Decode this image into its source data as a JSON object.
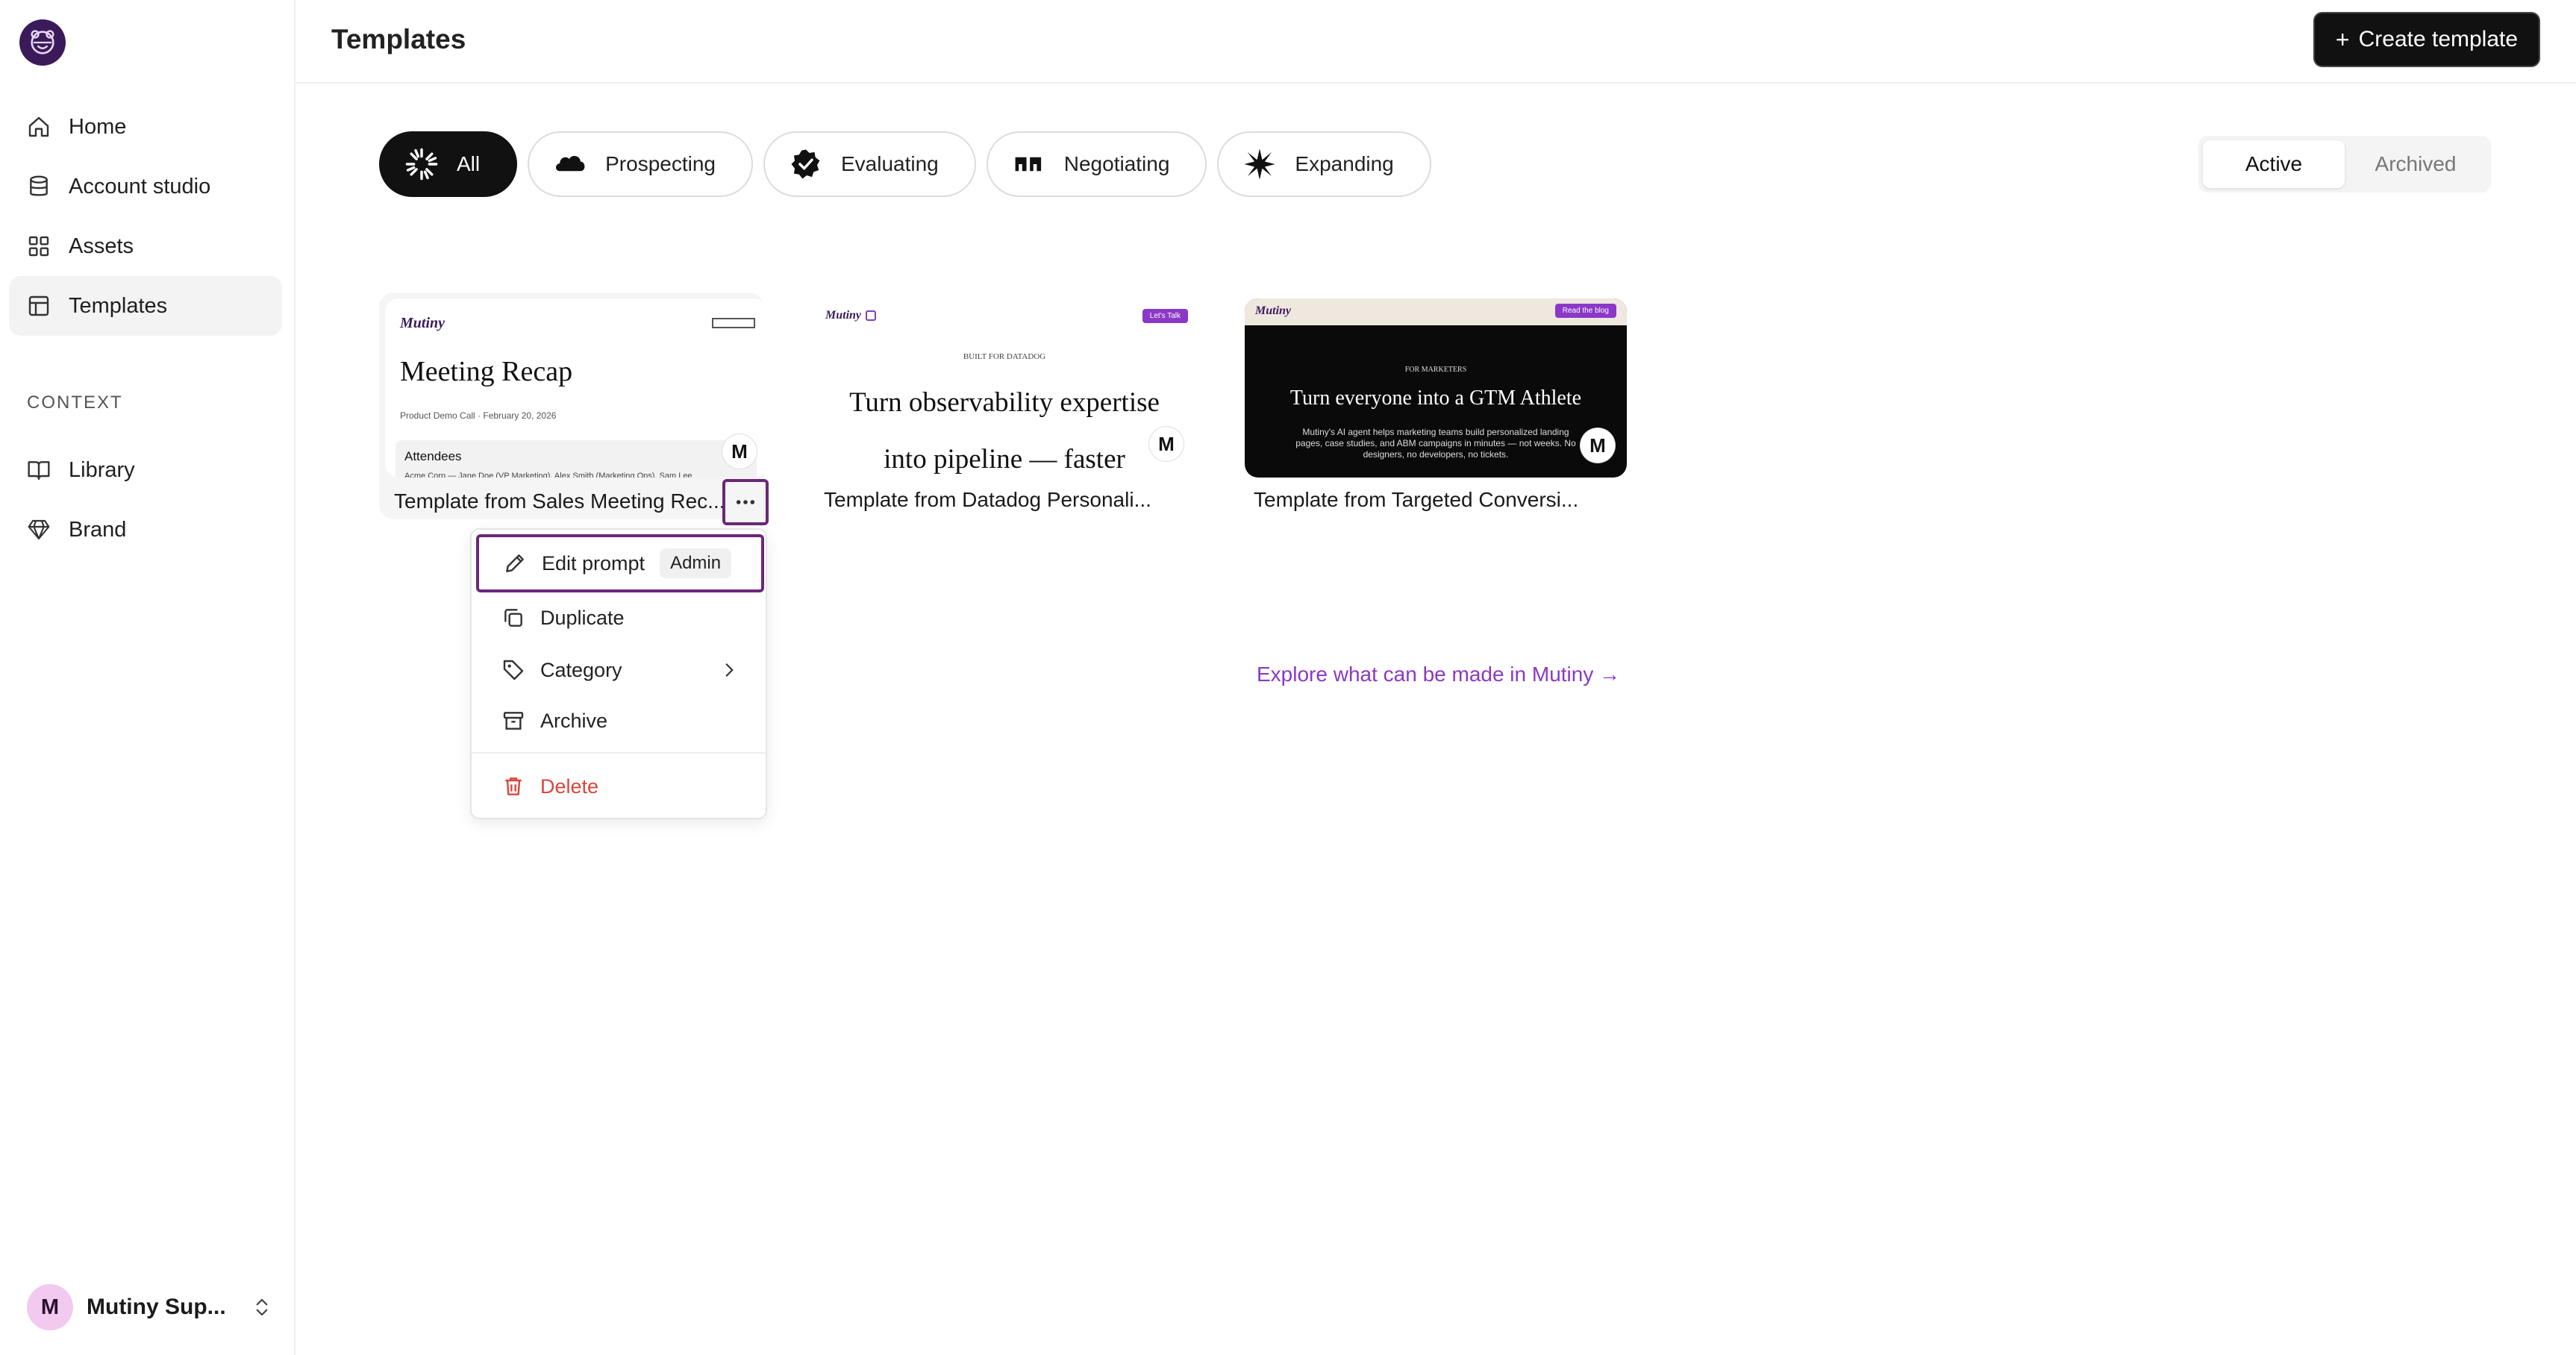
{
  "app": {
    "title": "Templates"
  },
  "sidebar": {
    "nav": [
      {
        "label": "Home",
        "icon": "home-icon"
      },
      {
        "label": "Account studio",
        "icon": "database-icon"
      },
      {
        "label": "Assets",
        "icon": "grid-icon"
      },
      {
        "label": "Templates",
        "icon": "template-icon",
        "active": true
      }
    ],
    "context_label": "CONTEXT",
    "context": [
      {
        "label": "Library",
        "icon": "book-icon"
      },
      {
        "label": "Brand",
        "icon": "gem-icon"
      }
    ],
    "user": {
      "initial": "M",
      "name": "Mutiny Sup..."
    }
  },
  "header": {
    "create_label": "Create template",
    "create_plus": "+"
  },
  "filters": [
    {
      "label": "All",
      "active": true
    },
    {
      "label": "Prospecting"
    },
    {
      "label": "Evaluating"
    },
    {
      "label": "Negotiating"
    },
    {
      "label": "Expanding"
    }
  ],
  "status_toggle": {
    "active": "Active",
    "archived": "Archived"
  },
  "cards": [
    {
      "title": "Template from Sales Meeting Rec...",
      "thumb": {
        "logo": "Mutiny",
        "heading": "Meeting Recap",
        "sub": "Product Demo Call · February 20, 2026",
        "section": "Attendees",
        "line": "Acme Corp — Jane Doe (VP Marketing), Alex Smith (Marketing Ops), Sam Lee"
      },
      "badge": "M"
    },
    {
      "title": "Template from Datadog Personali...",
      "thumb": {
        "logo": "Mutiny",
        "cta": "Let's Talk",
        "kicker": "BUILT FOR DATADOG",
        "heading1": "Turn observability expertise",
        "heading2": "into pipeline — faster"
      },
      "badge": "M"
    },
    {
      "title": "Template from Targeted Conversi...",
      "thumb": {
        "logo": "Mutiny",
        "cta": "Read the blog",
        "kicker": "FOR MARKETERS",
        "heading": "Turn everyone into a GTM Athlete",
        "body1": "Mutiny's AI agent helps marketing teams build personalized landing",
        "body2": "pages, case studies, and ABM campaigns in minutes — not weeks. No",
        "body3": "designers, no developers, no tickets."
      },
      "badge": "M"
    }
  ],
  "menu": {
    "edit_prompt": "Edit prompt",
    "admin_badge": "Admin",
    "duplicate": "Duplicate",
    "category": "Category",
    "archive": "Archive",
    "delete": "Delete"
  },
  "explore_link": "Explore what can be made in Mutiny →",
  "colors": {
    "accent": "#6b2878",
    "link": "#8b38c7",
    "danger": "#d9463b",
    "logo_bg": "#3b1a5a"
  }
}
